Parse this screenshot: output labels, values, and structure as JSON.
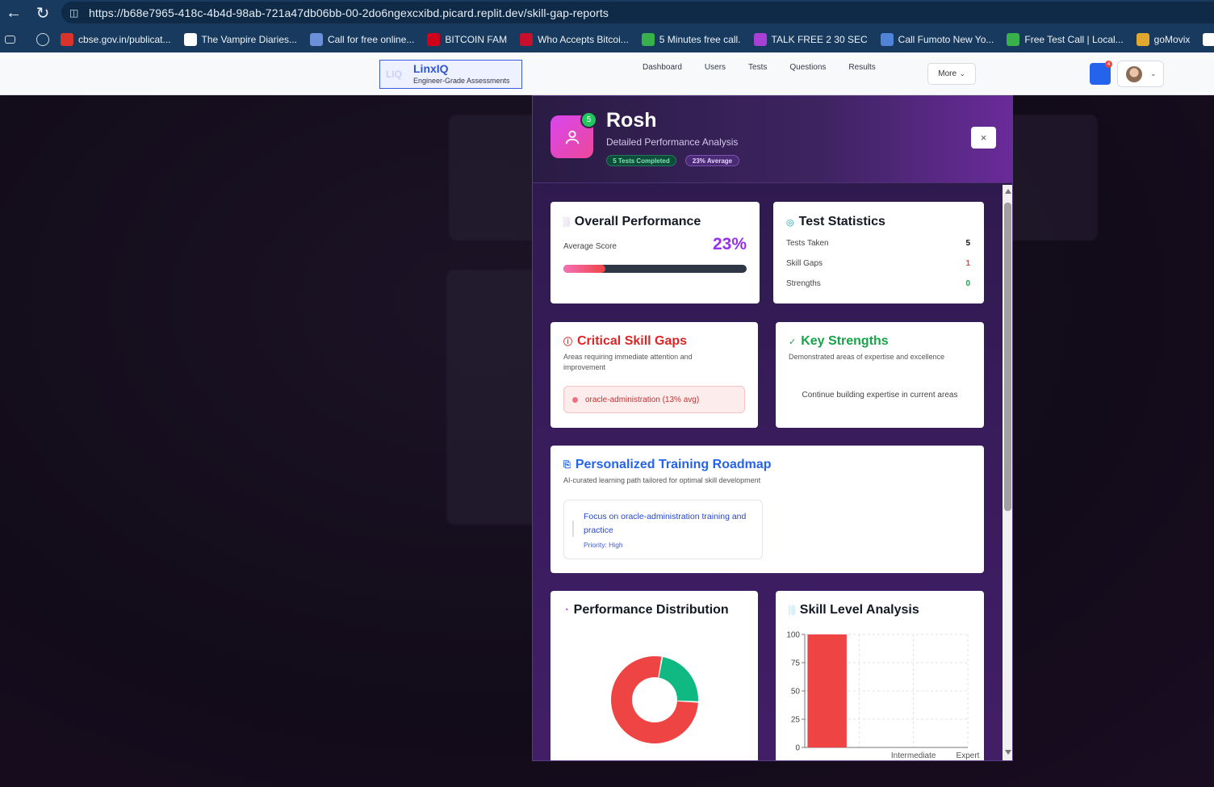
{
  "browser": {
    "url": "https://b68e7965-418c-4b4d-98ab-721a47db06bb-00-2do6ngexcxibd.picard.replit.dev/skill-gap-reports",
    "bookmarks": [
      {
        "label": "cbse.gov.in/publicat...",
        "icon_color": "#d9342b",
        "icon": "pdf-icon"
      },
      {
        "label": "The Vampire Diaries...",
        "icon_color": "#ffffff",
        "icon": "page-icon"
      },
      {
        "label": "Call for free online...",
        "icon_color": "#6b8fd8",
        "icon": "phone-icon"
      },
      {
        "label": "BITCOIN FAM",
        "icon_color": "#d0021b",
        "icon": "netflix-icon"
      },
      {
        "label": "Who Accepts Bitcoi...",
        "icon_color": "#c8102e",
        "icon": "99-icon"
      },
      {
        "label": "5 Minutes free call.",
        "icon_color": "#38b04b",
        "icon": "call-icon"
      },
      {
        "label": "TALK FREE 2 30 SEC",
        "icon_color": "#a83fd6",
        "icon": "chat-icon"
      },
      {
        "label": "Call Fumoto New Yo...",
        "icon_color": "#4f84d6",
        "icon": "chart-icon"
      },
      {
        "label": "Free Test Call | Local...",
        "icon_color": "#38b04b",
        "icon": "call-icon"
      },
      {
        "label": "goMovix",
        "icon_color": "#e0a82e",
        "icon": "film-icon"
      },
      {
        "label": "W",
        "icon_color": "#ffffff",
        "icon": "page-icon"
      }
    ]
  },
  "app": {
    "brand_mark": "LIQ",
    "brand_name": "LinxIQ",
    "brand_subtitle": "Engineer-Grade Assessments",
    "nav": [
      "Dashboard",
      "Users",
      "Tests",
      "Questions",
      "Results"
    ],
    "more_label": "More",
    "notification_count": "4"
  },
  "modal": {
    "name": "Rosh",
    "subtitle": "Detailed Performance Analysis",
    "badge_count": "5",
    "chip_tests": "5 Tests Completed",
    "chip_average": "23% Average",
    "close": "×",
    "overall": {
      "title": "Overall Performance",
      "avg_label": "Average Score",
      "avg_value": "23%",
      "progress": 0.23
    },
    "stats": {
      "title": "Test Statistics",
      "rows": [
        {
          "label": "Tests Taken",
          "value": "5",
          "color": "#111111"
        },
        {
          "label": "Skill Gaps",
          "value": "1",
          "color": "#e53e3e"
        },
        {
          "label": "Strengths",
          "value": "0",
          "color": "#16a34a"
        }
      ]
    },
    "gaps": {
      "title": "Critical Skill Gaps",
      "desc": "Areas requiring immediate attention and improvement",
      "items": [
        "oracle-administration (13% avg)"
      ]
    },
    "strengths": {
      "title": "Key Strengths",
      "desc": "Demonstrated areas of expertise and excellence",
      "empty": "Continue building expertise in current areas"
    },
    "roadmap": {
      "title": "Personalized Training Roadmap",
      "desc": "AI-curated learning path tailored for optimal skill development",
      "items": [
        {
          "text": "Focus on oracle-administration training and practice",
          "priority": "Priority: High"
        }
      ]
    },
    "distribution": {
      "title": "Performance Distribution"
    },
    "skill_level": {
      "title": "Skill Level Analysis"
    }
  },
  "chart_data": [
    {
      "type": "pie",
      "title": "Performance Distribution",
      "slices": [
        {
          "value": 77,
          "color": "#ef4444"
        },
        {
          "value": 23,
          "color": "#10b981"
        }
      ]
    },
    {
      "type": "bar",
      "title": "Skill Level Analysis",
      "categories": [
        "",
        "Intermediate",
        "Expert"
      ],
      "values": [
        100,
        0,
        0
      ],
      "ylim": [
        0,
        100
      ],
      "yticks": [
        "0",
        "25",
        "50",
        "75",
        "100"
      ],
      "color": "#ef4444",
      "grid": true
    }
  ]
}
